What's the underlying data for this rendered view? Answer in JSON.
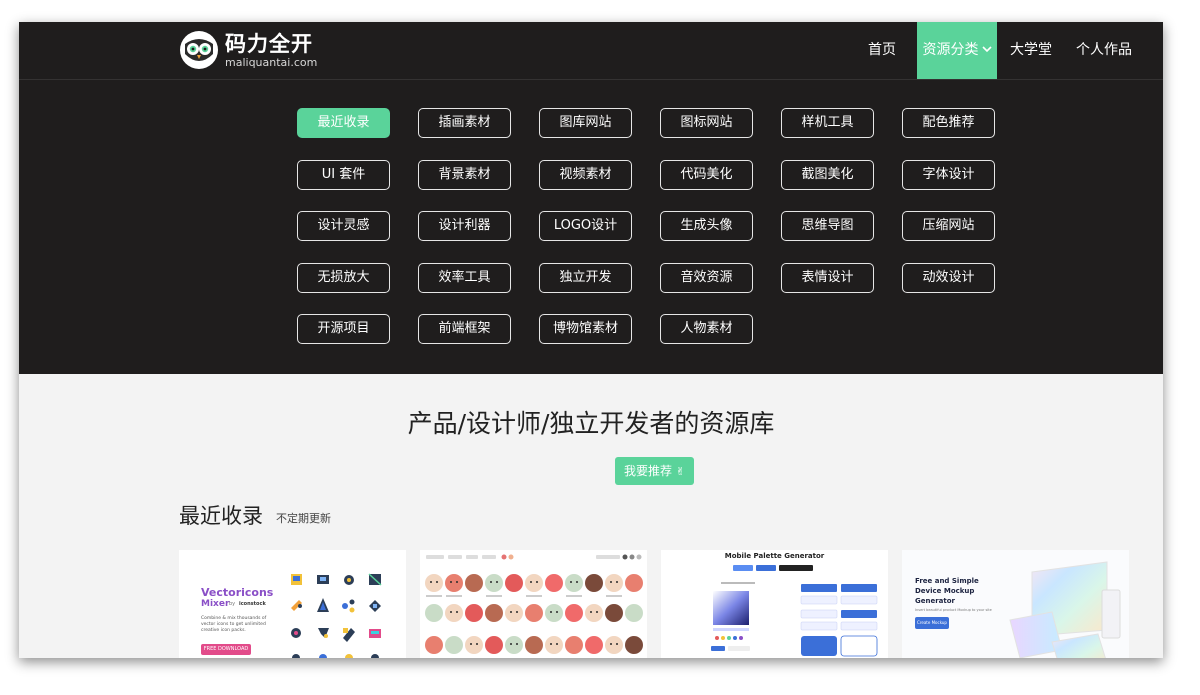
{
  "header": {
    "logo_cn": "码力全开",
    "logo_en": "maliquantai.com",
    "nav": [
      {
        "label": "首页"
      },
      {
        "label": "资源分类"
      },
      {
        "label": "大学堂"
      },
      {
        "label": "个人作品"
      }
    ],
    "accent_color": "#5ad39a"
  },
  "categories": [
    "最近收录",
    "插画素材",
    "图库网站",
    "图标网站",
    "样机工具",
    "配色推荐",
    "UI 套件",
    "背景素材",
    "视频素材",
    "代码美化",
    "截图美化",
    "字体设计",
    "设计灵感",
    "设计利器",
    "LOGO设计",
    "生成头像",
    "思维导图",
    "压缩网站",
    "无损放大",
    "效率工具",
    "独立开发",
    "音效资源",
    "表情设计",
    "动效设计",
    "开源项目",
    "前端框架",
    "博物馆素材",
    "人物素材"
  ],
  "active_category": "最近收录",
  "hero": {
    "title": "产品/设计师/独立开发者的资源库",
    "button": "我要推荐"
  },
  "section": {
    "title": "最近收录",
    "subtitle": "不定期更新"
  },
  "cards": {
    "vectoricons": {
      "title_line1": "Vectoricons",
      "title_line2": "Mixer",
      "by": "by",
      "brand": "iconstock",
      "desc1": "Combine & mix thousands of",
      "desc2": "vector icons to get unlimited",
      "desc3": "creative icon packs.",
      "cta": "FREE DOWNLOAD"
    },
    "palette": {
      "title": "Mobile Palette Generator"
    },
    "mockup": {
      "title1": "Free and Simple",
      "title2": "Device Mockup",
      "title3": "Generator",
      "sub": "Insert beautiful product Mockup to your site",
      "cta": "Create Mockup"
    }
  }
}
